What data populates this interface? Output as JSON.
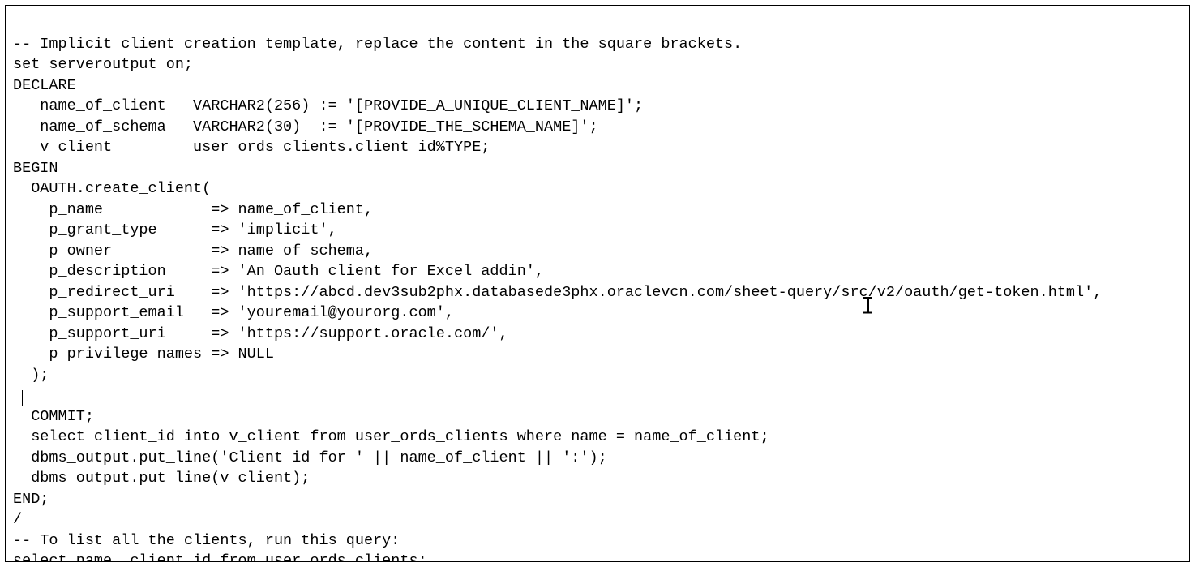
{
  "code": {
    "lines": [
      "-- Implicit client creation template, replace the content in the square brackets.",
      "set serveroutput on;",
      "DECLARE",
      "   name_of_client   VARCHAR2(256) := '[PROVIDE_A_UNIQUE_CLIENT_NAME]';",
      "   name_of_schema   VARCHAR2(30)  := '[PROVIDE_THE_SCHEMA_NAME]';",
      "   v_client         user_ords_clients.client_id%TYPE;",
      "BEGIN",
      "  OAUTH.create_client(",
      "    p_name            => name_of_client,",
      "    p_grant_type      => 'implicit',",
      "    p_owner           => name_of_schema,",
      "    p_description     => 'An Oauth client for Excel addin',",
      "    p_redirect_uri    => 'https://abcd.dev3sub2phx.databasede3phx.oraclevcn.com/sheet-query/src/v2/oauth/get-token.html',",
      "    p_support_email   => 'youremail@yourorg.com',",
      "    p_support_uri     => 'https://support.oracle.com/',",
      "    p_privilege_names => NULL",
      "  );",
      " ",
      "  COMMIT;",
      "  select client_id into v_client from user_ords_clients where name = name_of_client;",
      "  dbms_output.put_line('Client id for ' || name_of_client || ':');",
      "  dbms_output.put_line(v_client);",
      "END;",
      "/",
      "-- To list all the clients, run this query:",
      "select name, client_id from user_ords_clients;"
    ]
  }
}
